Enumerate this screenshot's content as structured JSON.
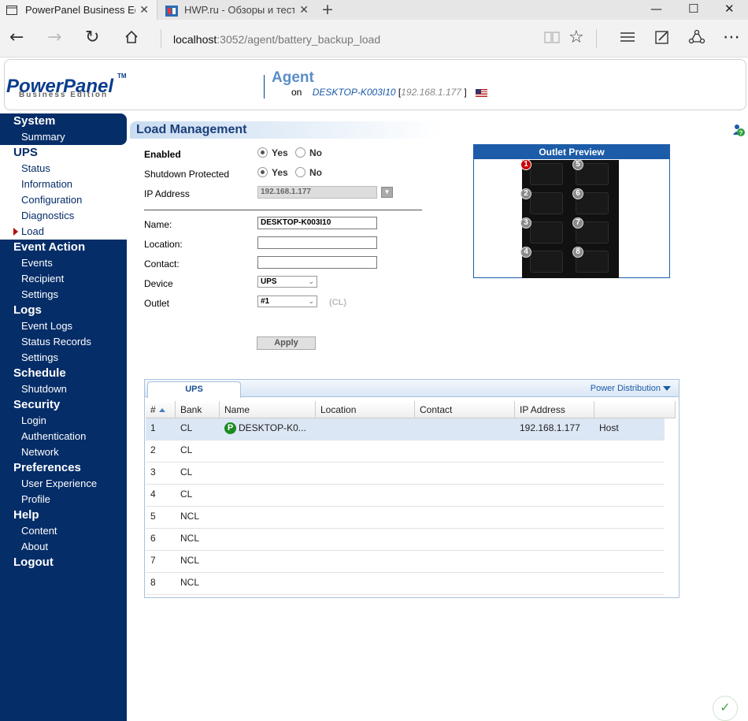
{
  "browser": {
    "tabs": [
      {
        "title": "PowerPanel Business Ed",
        "active": true
      },
      {
        "title": "HWP.ru - Обзоры и тесты к",
        "active": false
      }
    ],
    "url_host": "localhost",
    "url_rest": ":3052/agent/battery_backup_load",
    "window_controls": {
      "minimize": "—",
      "maximize": "☐",
      "close": "✕"
    }
  },
  "header": {
    "logo": "PowerPanel",
    "logo_tm": "TM",
    "logo_sub": "Business Edition",
    "title": "Agent",
    "on_label": "on",
    "hostname": "DESKTOP-K003I10",
    "ip_open": "[",
    "ip": "192.168.1.177",
    "ip_close": "]"
  },
  "sidebar": {
    "groups": [
      {
        "label": "System",
        "items": [
          "Summary"
        ]
      },
      {
        "label": "UPS",
        "items": [
          "Status",
          "Information",
          "Configuration",
          "Diagnostics",
          "Load"
        ]
      },
      {
        "label": "Event Action",
        "items": [
          "Events",
          "Recipient",
          "Settings"
        ]
      },
      {
        "label": "Logs",
        "items": [
          "Event Logs",
          "Status Records",
          "Settings"
        ]
      },
      {
        "label": "Schedule",
        "items": [
          "Shutdown"
        ]
      },
      {
        "label": "Security",
        "items": [
          "Login",
          "Authentication",
          "Network"
        ]
      },
      {
        "label": "Preferences",
        "items": [
          "User Experience",
          "Profile"
        ]
      },
      {
        "label": "Help",
        "items": [
          "Content",
          "About"
        ]
      },
      {
        "label": "Logout",
        "items": []
      }
    ],
    "active_item": "Load"
  },
  "page": {
    "title": "Load Management",
    "enabled_label": "Enabled",
    "shutdown_label": "Shutdown Protected",
    "yes": "Yes",
    "no": "No",
    "enabled_value": "Yes",
    "shutdown_value": "Yes",
    "ip_label": "IP Address",
    "ip_value": "192.168.1.177",
    "name_label": "Name:",
    "name_value": "DESKTOP-K003I10",
    "location_label": "Location:",
    "location_value": "",
    "contact_label": "Contact:",
    "contact_value": "",
    "device_label": "Device",
    "device_value": "UPS",
    "outlet_label": "Outlet",
    "outlet_value": "#1",
    "outlet_bank": "(CL)",
    "apply": "Apply"
  },
  "outlet_preview": {
    "title": "Outlet Preview",
    "outlets": [
      "1",
      "2",
      "3",
      "4",
      "5",
      "6",
      "7",
      "8"
    ],
    "selected": "1"
  },
  "table": {
    "tab": "UPS",
    "power_distribution": "Power Distribution",
    "columns": [
      "#",
      "Bank",
      "Name",
      "Location",
      "Contact",
      "IP Address",
      ""
    ],
    "rows": [
      {
        "num": "1",
        "bank": "CL",
        "name": "DESKTOP-K0...",
        "location": "",
        "contact": "",
        "ip": "192.168.1.177",
        "type": "Host",
        "selected": true
      },
      {
        "num": "2",
        "bank": "CL",
        "name": "",
        "location": "",
        "contact": "",
        "ip": "",
        "type": ""
      },
      {
        "num": "3",
        "bank": "CL",
        "name": "",
        "location": "",
        "contact": "",
        "ip": "",
        "type": ""
      },
      {
        "num": "4",
        "bank": "CL",
        "name": "",
        "location": "",
        "contact": "",
        "ip": "",
        "type": ""
      },
      {
        "num": "5",
        "bank": "NCL",
        "name": "",
        "location": "",
        "contact": "",
        "ip": "",
        "type": ""
      },
      {
        "num": "6",
        "bank": "NCL",
        "name": "",
        "location": "",
        "contact": "",
        "ip": "",
        "type": ""
      },
      {
        "num": "7",
        "bank": "NCL",
        "name": "",
        "location": "",
        "contact": "",
        "ip": "",
        "type": ""
      },
      {
        "num": "8",
        "bank": "NCL",
        "name": "",
        "location": "",
        "contact": "",
        "ip": "",
        "type": ""
      }
    ]
  },
  "colors": {
    "sidebar": "#052d68",
    "accent": "#1c5ca8",
    "selected_outlet": "#cc0000"
  }
}
